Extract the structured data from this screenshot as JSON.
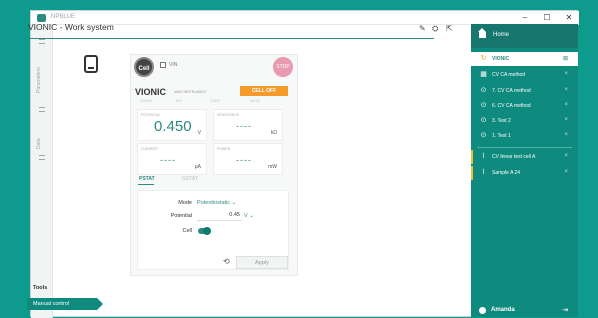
{
  "titlebar": {
    "app_name": "NPBLUE",
    "minimize": "–",
    "maximize": "☐",
    "close": "✕"
  },
  "left_strip": {
    "label_a": "Parameters",
    "label_b": "Data"
  },
  "panel": {
    "title": "VIONIC - Work system"
  },
  "toolbar": {
    "edit": "✎",
    "settings": "⛭",
    "open": "⇱"
  },
  "device_panel": {
    "tools_label": "Tools",
    "manual_control_label": "Manual control"
  },
  "instrument": {
    "cell_button": "Cell",
    "vin_label": "VIN",
    "stop_button": "STOP",
    "brand": "VIONIC",
    "brand_sub": "MAIN INSTRUMENT",
    "cell_status": "CELL OFF",
    "faint_labels": [
      "RANGE",
      "BW",
      "CURR",
      "MODE"
    ],
    "potential": {
      "label": "POTENTIAL",
      "value": "0.450",
      "unit": "V"
    },
    "resistance": {
      "label": "RESISTANCE",
      "value": "----",
      "unit": "kΩ"
    },
    "current": {
      "label": "CURRENT",
      "value": "----",
      "unit": "μA"
    },
    "power": {
      "label": "POWER",
      "value": "----",
      "unit": "mW"
    },
    "tab_active": "PSTAT",
    "tab_inactive": "GSTAT",
    "mode_label": "Mode",
    "mode_value": "Potentiostatic",
    "potential_label": "Potential",
    "potential_input": "0.45",
    "potential_unit": "V",
    "cell_label": "Cell",
    "cell_on": true,
    "apply_label": "Apply"
  },
  "right_panel": {
    "home_label": "Home",
    "items": [
      {
        "label": "VIONIC",
        "icon": "↻",
        "selected": true,
        "close": "⊠"
      },
      {
        "label": "CV CA method",
        "icon": "▦",
        "close": "×"
      },
      {
        "label": "7. CV CA method",
        "icon": "⊙",
        "close": "×"
      },
      {
        "label": "6. CV CA method",
        "icon": "⊙",
        "close": "×"
      },
      {
        "label": "3. Test 2",
        "icon": "⊙",
        "close": "×"
      },
      {
        "label": "1. Test 1",
        "icon": "⊙",
        "close": "×"
      },
      {
        "label": "CV linear test cell A",
        "icon": "⌇",
        "close": "×"
      },
      {
        "label": "Sample A 24",
        "icon": "⌇",
        "close": "×"
      }
    ],
    "user": "Amanda",
    "logout_icon": "⇥"
  }
}
